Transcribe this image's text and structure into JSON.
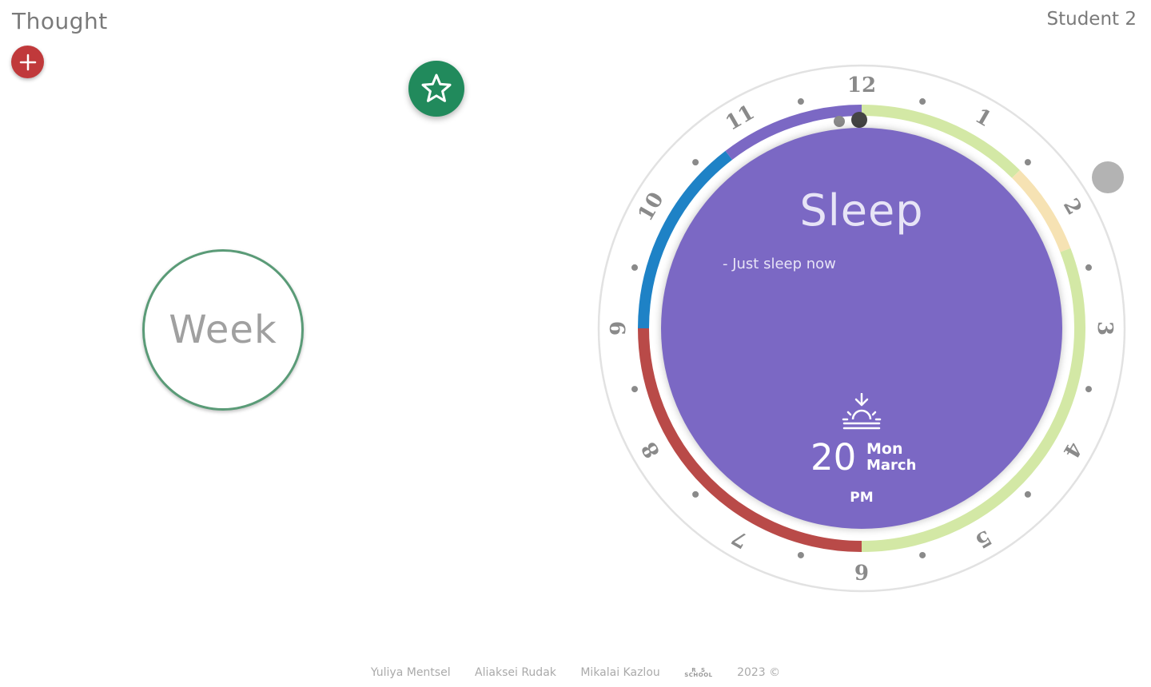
{
  "header": {
    "app_title": "Thought",
    "user_name": "Student 2"
  },
  "actions": {
    "add_icon": "plus-icon",
    "star_icon": "star-icon"
  },
  "week": {
    "label": "Week"
  },
  "clock": {
    "hour_labels": [
      "12",
      "1",
      "2",
      "3",
      "4",
      "5",
      "6",
      "7",
      "8",
      "9",
      "10",
      "11"
    ],
    "activity_title": "Sleep",
    "activity_note": "- Just sleep now",
    "date_icon": "sunrise-icon",
    "day": "20",
    "weekday": "Mon",
    "month": "March",
    "ampm": "PM",
    "segments": [
      {
        "from": 0,
        "to": 1.5,
        "color": "#d3e8a5"
      },
      {
        "from": 1.5,
        "to": 2.3,
        "color": "#f6e2b3"
      },
      {
        "from": 2.3,
        "to": 6,
        "color": "#d3e8a5"
      },
      {
        "from": 6,
        "to": 9,
        "color": "#b94a48"
      },
      {
        "from": 9,
        "to": 10.75,
        "color": "#1e82c6"
      },
      {
        "from": 10.75,
        "to": 12,
        "color": "#7b68c4"
      }
    ],
    "face_color": "#7b68c4"
  },
  "footer": {
    "authors": [
      "Yuliya Mentsel",
      "Aliaksei Rudak",
      "Mikalai Kazlou"
    ],
    "school_logo_text": "RS SCHOOL",
    "copyright": "2023 ©"
  }
}
